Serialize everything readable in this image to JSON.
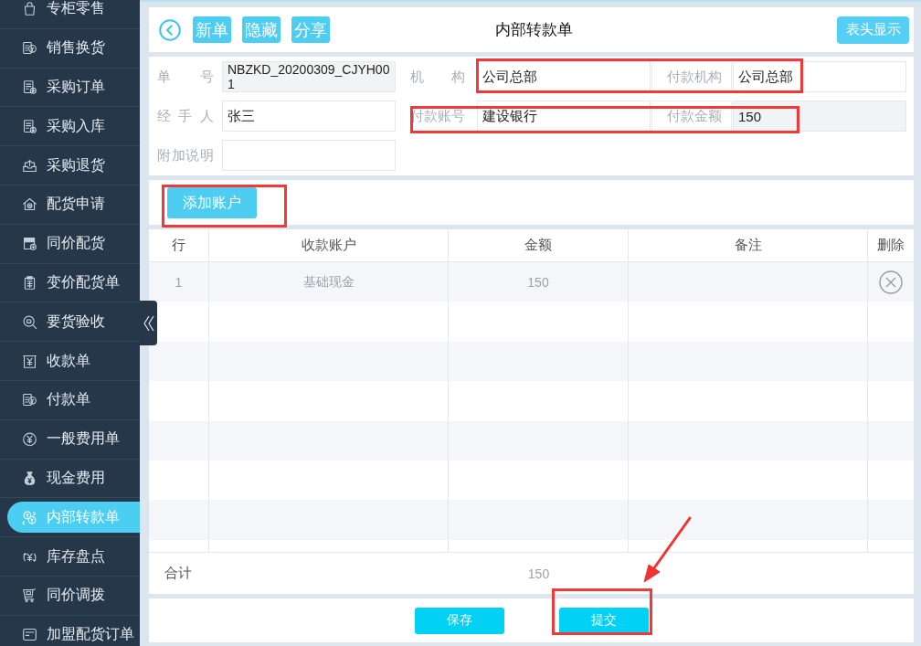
{
  "sidebar": {
    "items": [
      {
        "label": "专柜零售",
        "selected": false
      },
      {
        "label": "销售换货",
        "selected": false
      },
      {
        "label": "采购订单",
        "selected": false
      },
      {
        "label": "采购入库",
        "selected": false
      },
      {
        "label": "采购退货",
        "selected": false
      },
      {
        "label": "配货申请",
        "selected": false
      },
      {
        "label": "同价配货",
        "selected": false
      },
      {
        "label": "变价配货单",
        "selected": false
      },
      {
        "label": "要货验收",
        "selected": false
      },
      {
        "label": "收款单",
        "selected": false
      },
      {
        "label": "付款单",
        "selected": false
      },
      {
        "label": "一般费用单",
        "selected": false
      },
      {
        "label": "现金费用",
        "selected": false
      },
      {
        "label": "内部转款单",
        "selected": true
      },
      {
        "label": "库存盘点",
        "selected": false
      },
      {
        "label": "同价调拨",
        "selected": false
      },
      {
        "label": "加盟配货订单",
        "selected": false
      }
    ]
  },
  "header": {
    "buttons": [
      "新单",
      "隐藏",
      "分享"
    ],
    "title": "内部转款单",
    "right_button": "表头显示"
  },
  "form": {
    "rows": [
      [
        {
          "label": "单 号",
          "value": "NBZKD_20200309_CJYH001",
          "readonly": true
        },
        {
          "label": "机 构",
          "value": "公司总部",
          "readonly": false
        },
        {
          "label": "付款机构",
          "value": "公司总部",
          "readonly": false
        }
      ],
      [
        {
          "label": "经 手 人",
          "value": "张三",
          "readonly": false
        },
        {
          "label": "付款账号",
          "value": "建设银行",
          "readonly": false
        },
        {
          "label": "付款金额",
          "value": "150",
          "readonly": true
        }
      ],
      [
        {
          "label": "附加说明",
          "readonly": false
        }
      ]
    ]
  },
  "actions": {
    "add_button": "添加账户"
  },
  "table": {
    "columns": [
      "行",
      "收款账户",
      "金额",
      "备注",
      "删除"
    ],
    "rows": [
      {
        "line": "1",
        "account": "基础现金",
        "amount": "150"
      }
    ],
    "total": {
      "label": "合计",
      "amount": "150"
    }
  },
  "footer": {
    "buttons": [
      "保存",
      "提交"
    ]
  },
  "annotations": [
    {
      "kind": "frame"
    },
    {
      "kind": "frame"
    },
    {
      "kind": "frame"
    },
    {
      "kind": "frame"
    },
    {
      "kind": "arrow"
    }
  ]
}
